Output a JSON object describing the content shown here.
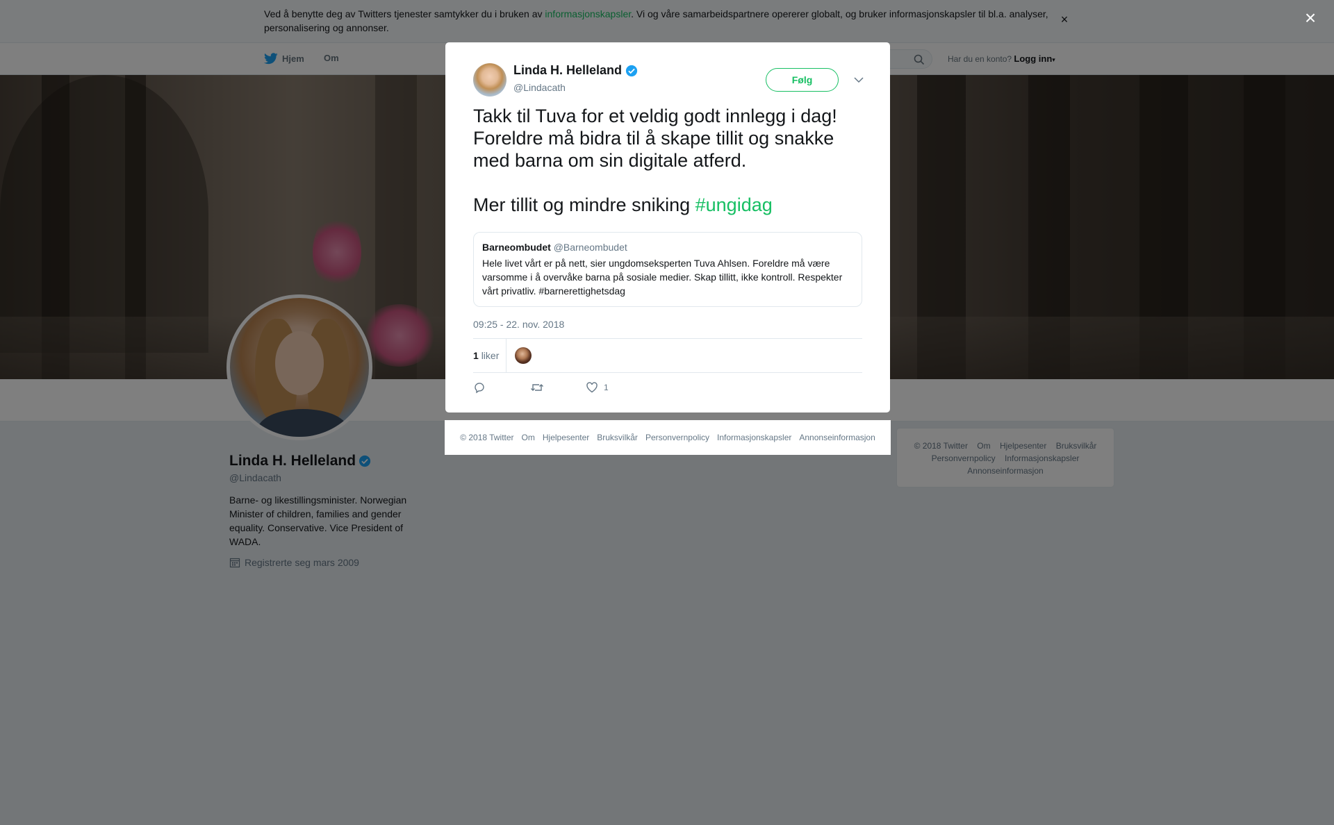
{
  "cookie_banner": {
    "text_before": "Ved å benytte deg av Twitters tjenester samtykker du i bruken av ",
    "link": "informasjonskapsler",
    "text_after": ". Vi og våre samarbeidspartnere opererer globalt, og bruker informasjonskapsler til bl.a. analyser, personalisering og annonser.",
    "close": "×"
  },
  "nav": {
    "home": "Hjem",
    "about": "Om",
    "login_prompt": "Har du en konto?",
    "login_link": "Logg inn"
  },
  "profile": {
    "name": "Linda H. Helleland",
    "handle": "@Lindacath",
    "bio": "Barne- og likestillingsminister. Norwegian Minister of children, families and gender equality. Conservative. Vice President of WADA.",
    "joined": "Registrerte seg mars 2009"
  },
  "side_footer": {
    "items": [
      "© 2018 Twitter",
      "Om",
      "Hjelpesenter",
      "Bruksvilkår",
      "Personvernpolicy",
      "Informasjonskapsler",
      "Annonseinformasjon"
    ]
  },
  "overlay": {
    "close": "×"
  },
  "tweet": {
    "author_name": "Linda H. Helleland",
    "author_handle": "@Lindacath",
    "follow_label": "Følg",
    "paragraph1": "Takk til Tuva for et veldig godt innlegg i dag! Foreldre må bidra til å skape tillit og snakke med barna om sin digitale atferd.",
    "paragraph2_text": "Mer tillit og mindre sniking ",
    "hashtag": "#ungidag",
    "quote": {
      "name": "Barneombudet",
      "handle": "@Barneombudet",
      "text": "Hele livet vårt er på nett, sier ungdomseksperten Tuva Ahlsen. Foreldre må være varsomme i å overvåke barna på sosiale medier. Skap tillitt, ikke kontroll. Respekter vårt privatliv. #barnerettighetsdag"
    },
    "timestamp": "09:25 - 22. nov. 2018",
    "likes_count": "1",
    "likes_label": "liker",
    "like_action_count": "1"
  },
  "modal_footer": {
    "items": [
      "© 2018 Twitter",
      "Om",
      "Hjelpesenter",
      "Bruksvilkår",
      "Personvernpolicy",
      "Informasjonskapsler",
      "Annonseinformasjon"
    ]
  },
  "colors": {
    "accent": "#17bf63",
    "verified": "#1da1f2",
    "muted": "#657786"
  },
  "icons": {
    "nav_home": "twitter-bird-icon",
    "search": "search-icon",
    "verified": "verified-badge-icon",
    "calendar": "calendar-icon",
    "caret": "chevron-down-icon",
    "reply": "reply-icon",
    "retweet": "retweet-icon",
    "like": "heart-icon"
  }
}
